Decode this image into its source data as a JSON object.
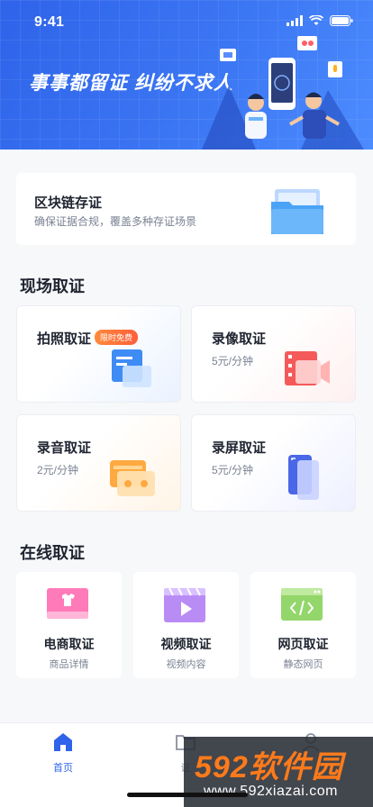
{
  "status": {
    "time": "9:41"
  },
  "banner": {
    "slogan": "事事都留证 纠纷不求人"
  },
  "chain": {
    "title": "区块链存证",
    "subtitle": "确保证据合规，覆盖多种存证场景"
  },
  "scene_section": {
    "title": "现场取证"
  },
  "scene_cards": [
    {
      "title": "拍照取证",
      "badge": "限时免费",
      "price": ""
    },
    {
      "title": "录像取证",
      "price": "5元/分钟"
    },
    {
      "title": "录音取证",
      "price": "2元/分钟"
    },
    {
      "title": "录屏取证",
      "price": "5元/分钟"
    }
  ],
  "online_section": {
    "title": "在线取证"
  },
  "online_cards": [
    {
      "title": "电商取证",
      "subtitle": "商品详情"
    },
    {
      "title": "视频取证",
      "subtitle": "视频内容"
    },
    {
      "title": "网页取证",
      "subtitle": "静态网页"
    }
  ],
  "tabbar": {
    "items": [
      {
        "label": "首页",
        "icon": "home-icon"
      },
      {
        "label": "证",
        "icon": "folder-icon"
      },
      {
        "label": "",
        "icon": "user-icon"
      }
    ]
  },
  "watermark": {
    "logo": "592软件园",
    "url": "www.592xiazai.com"
  },
  "colors": {
    "primary": "#2f63ea",
    "badge": "#ff5e3a",
    "watermark_logo": "#ff7a1a"
  }
}
